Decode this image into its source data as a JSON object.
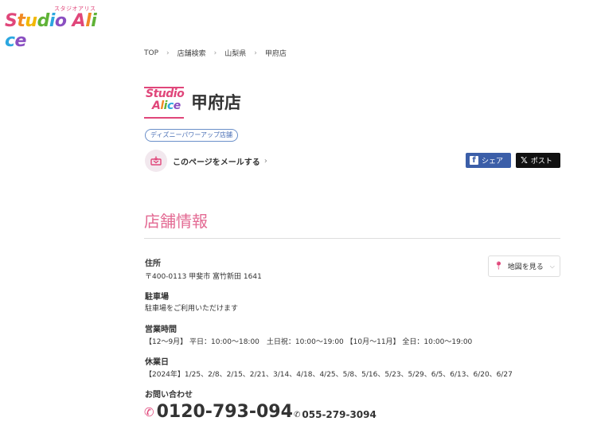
{
  "logo": {
    "kana": "スタジオアリス",
    "word": "Studio Alice"
  },
  "breadcrumb": [
    "TOP",
    "店舗検索",
    "山梨県",
    "甲府店"
  ],
  "store": {
    "logo_line1": "Studio",
    "logo_line2": "Alice",
    "name": "甲府店",
    "badge": "ディズニーパワーアップ店舗"
  },
  "mail_link": "このページをメールする",
  "share": {
    "facebook_label": "シェア",
    "x_label": "ポスト"
  },
  "section_title": "店舗情報",
  "info": {
    "address_label": "住所",
    "address_value": "〒400-0113 甲斐市 富竹新田 1641",
    "map_button": "地図を見る",
    "parking_label": "駐車場",
    "parking_value": "駐車場をご利用いただけます",
    "hours_label": "営業時間",
    "hours_value": "【12〜9月】 平日：10:00〜18:00　土日祝：10:00〜19:00 【10月〜11月】 全日：10:00〜19:00",
    "holidays_label": "休業日",
    "holidays_value": "【2024年】1/25、2/8、2/15、2/21、3/14、4/18、4/25、5/8、5/16、5/23、5/29、6/5、6/13、6/20、6/27",
    "contact_label": "お問い合わせ",
    "phone_free": "0120-793-094",
    "phone_local": "055-279-3094"
  },
  "colors": {
    "accent_pink": "#e0467a",
    "section_pink": "#e36a93",
    "facebook_blue": "#3b5ea8",
    "x_black": "#111111"
  }
}
